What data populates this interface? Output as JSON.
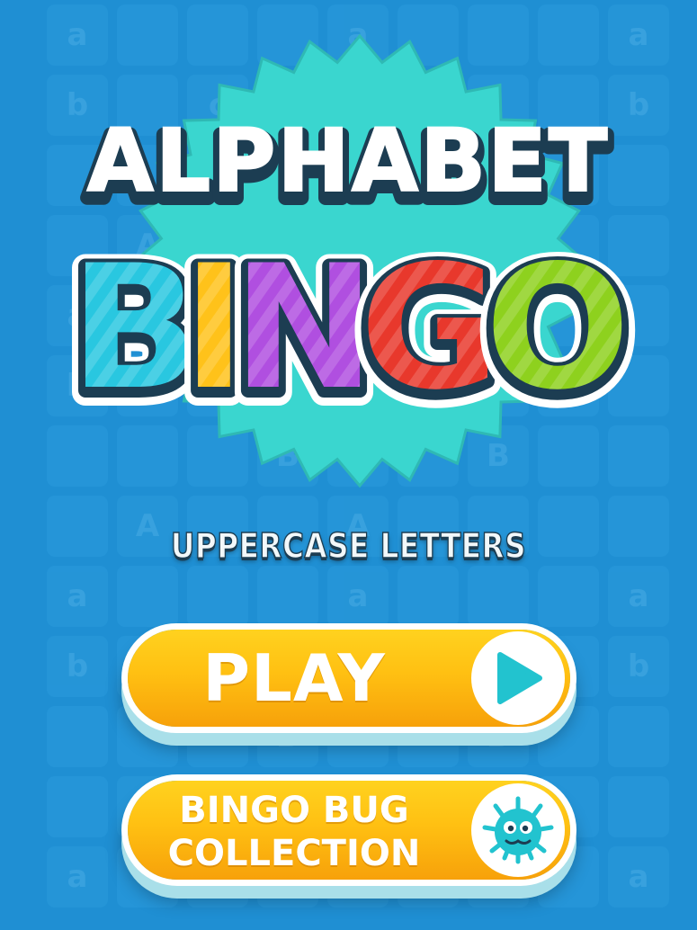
{
  "logo": {
    "word1": "ALPHABET",
    "word2_letters": [
      {
        "char": "B",
        "color": "#29c7e0"
      },
      {
        "char": "I",
        "color": "#ffc21a"
      },
      {
        "char": "N",
        "color": "#b04fe0"
      },
      {
        "char": "G",
        "color": "#e8382c"
      },
      {
        "char": "O",
        "color": "#8ed11e"
      }
    ],
    "badge_color": "#3ad6cf"
  },
  "subtitle": "UPPERCASE LETTERS",
  "buttons": {
    "play_label": "PLAY",
    "play_icon": "play-triangle-icon",
    "bugs_line1": "BINGO BUG",
    "bugs_line2": "COLLECTION",
    "bugs_icon": "bingo-bug-icon"
  },
  "background_tile_letters": [
    "a",
    "b",
    "c",
    "A",
    "B"
  ],
  "colors": {
    "background": "#1f8fd3",
    "button": "#ffc012",
    "icon_teal": "#22c3cf"
  }
}
